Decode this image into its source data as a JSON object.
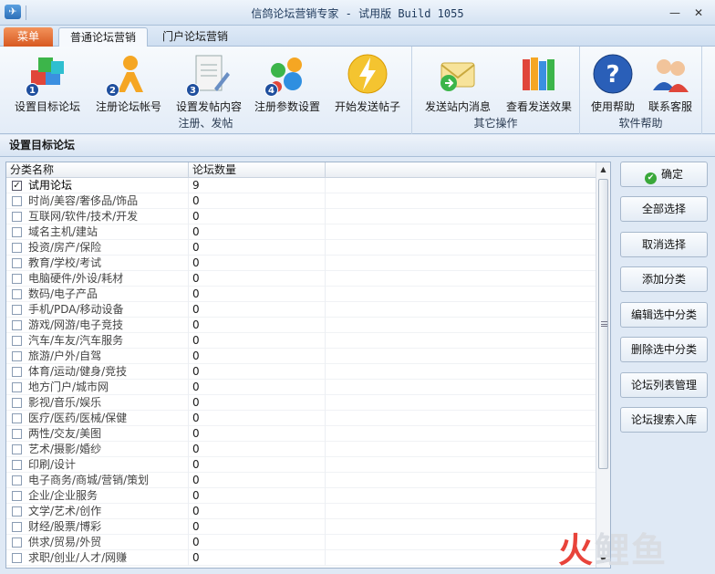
{
  "window": {
    "title": "信鸽论坛营销专家 - 试用版 Build 1055",
    "app_icon": "dove-app-icon",
    "controls": [
      "—",
      "✕"
    ]
  },
  "tabs": [
    {
      "label": "菜单",
      "state": "menu"
    },
    {
      "label": "普通论坛营销",
      "state": "active"
    },
    {
      "label": "门户论坛营销",
      "state": "inactive"
    }
  ],
  "ribbon": {
    "groups": [
      {
        "label": "注册、发帖",
        "buttons": [
          {
            "label": "设置目标论坛",
            "icon": "cubes-icon",
            "step": "1"
          },
          {
            "label": "注册论坛帐号",
            "icon": "user-register-icon",
            "step": "2"
          },
          {
            "label": "设置发帖内容",
            "icon": "document-edit-icon",
            "step": "3"
          },
          {
            "label": "注册参数设置",
            "icon": "settings-group-icon",
            "step": "4"
          },
          {
            "label": "开始发送帖子",
            "icon": "lightning-icon",
            "step": ""
          }
        ]
      },
      {
        "label": "其它操作",
        "buttons": [
          {
            "label": "发送站内消息",
            "icon": "envelope-icon"
          },
          {
            "label": "查看发送效果",
            "icon": "books-icon"
          }
        ]
      },
      {
        "label": "软件帮助",
        "buttons": [
          {
            "label": "使用帮助",
            "icon": "help-icon"
          },
          {
            "label": "联系客服",
            "icon": "support-icon"
          }
        ]
      }
    ]
  },
  "section": {
    "title": "设置目标论坛"
  },
  "table": {
    "columns": [
      "分类名称",
      "论坛数量"
    ],
    "rows": [
      {
        "name": "试用论坛",
        "count": "9",
        "checked": true
      },
      {
        "name": "时尚/美容/奢侈品/饰品",
        "count": "0",
        "checked": false
      },
      {
        "name": "互联网/软件/技术/开发",
        "count": "0",
        "checked": false
      },
      {
        "name": "域名主机/建站",
        "count": "0",
        "checked": false
      },
      {
        "name": "投资/房产/保险",
        "count": "0",
        "checked": false
      },
      {
        "name": "教育/学校/考试",
        "count": "0",
        "checked": false
      },
      {
        "name": "电脑硬件/外设/耗材",
        "count": "0",
        "checked": false
      },
      {
        "name": "数码/电子产品",
        "count": "0",
        "checked": false
      },
      {
        "name": "手机/PDA/移动设备",
        "count": "0",
        "checked": false
      },
      {
        "name": "游戏/网游/电子竞技",
        "count": "0",
        "checked": false
      },
      {
        "name": "汽车/车友/汽车服务",
        "count": "0",
        "checked": false
      },
      {
        "name": "旅游/户外/自驾",
        "count": "0",
        "checked": false
      },
      {
        "name": "体育/运动/健身/竞技",
        "count": "0",
        "checked": false
      },
      {
        "name": "地方门户/城市网",
        "count": "0",
        "checked": false
      },
      {
        "name": "影视/音乐/娱乐",
        "count": "0",
        "checked": false
      },
      {
        "name": "医疗/医药/医械/保健",
        "count": "0",
        "checked": false
      },
      {
        "name": "两性/交友/美图",
        "count": "0",
        "checked": false
      },
      {
        "name": "艺术/摄影/婚纱",
        "count": "0",
        "checked": false
      },
      {
        "name": "印刷/设计",
        "count": "0",
        "checked": false
      },
      {
        "name": "电子商务/商城/营销/策划",
        "count": "0",
        "checked": false
      },
      {
        "name": "企业/企业服务",
        "count": "0",
        "checked": false
      },
      {
        "name": "文学/艺术/创作",
        "count": "0",
        "checked": false
      },
      {
        "name": "财经/股票/博彩",
        "count": "0",
        "checked": false
      },
      {
        "name": "供求/贸易/外贸",
        "count": "0",
        "checked": false
      },
      {
        "name": "求职/创业/人才/网赚",
        "count": "0",
        "checked": false
      }
    ]
  },
  "side_buttons": [
    {
      "label": "确定",
      "icon": "check-circle-icon"
    },
    {
      "label": "全部选择"
    },
    {
      "label": "取消选择"
    },
    {
      "label": "添加分类"
    },
    {
      "label": "编辑选中分类"
    },
    {
      "label": "删除选中分类"
    },
    {
      "label": "论坛列表管理"
    },
    {
      "label": "论坛搜索入库"
    }
  ],
  "watermark": {
    "text1": "火",
    "text2": "鲤鱼"
  },
  "colors": {
    "menu_tab": "#e06a2e",
    "accent": "#1f4f9e",
    "panel": "#dfe9f5"
  }
}
